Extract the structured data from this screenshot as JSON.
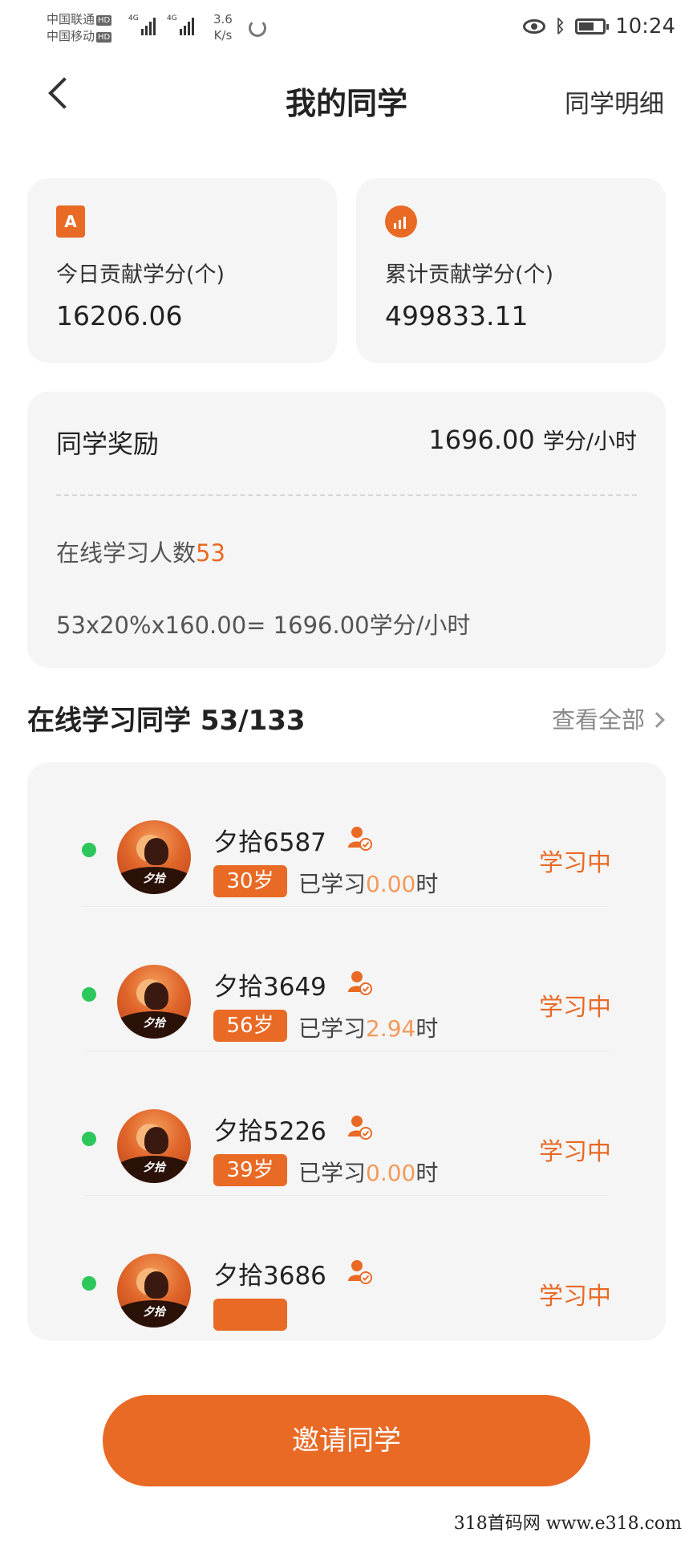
{
  "status_bar": {
    "carrier1": "中国联通",
    "carrier2": "中国移动",
    "hd": "HD",
    "net1": "4G",
    "net2": "4G",
    "speed_value": "3.6",
    "speed_unit": "K/s",
    "time": "10:24"
  },
  "nav": {
    "title": "我的同学",
    "detail_link": "同学明细"
  },
  "stats": {
    "today_label": "今日贡献学分(个)",
    "today_value": "16206.06",
    "total_label": "累计贡献学分(个)",
    "total_value": "499833.11"
  },
  "reward": {
    "title": "同学奖励",
    "rate_value": "1696.00",
    "rate_unit": "学分/小时",
    "online_label": "在线学习人数",
    "online_count": "53",
    "formula": "53x20%x160.00= 1696.00学分/小时"
  },
  "online_section": {
    "title": "在线学习同学 53/133",
    "view_all": "查看全部"
  },
  "classmates": [
    {
      "name": "夕拾6587",
      "age": "30岁",
      "studied_prefix": "已学习",
      "hours": "0.00",
      "hours_unit": "时",
      "state": "学习中",
      "avatar_text": "夕拾"
    },
    {
      "name": "夕拾3649",
      "age": "56岁",
      "studied_prefix": "已学习",
      "hours": "2.94",
      "hours_unit": "时",
      "state": "学习中",
      "avatar_text": "夕拾"
    },
    {
      "name": "夕拾5226",
      "age": "39岁",
      "studied_prefix": "已学习",
      "hours": "0.00",
      "hours_unit": "时",
      "state": "学习中",
      "avatar_text": "夕拾"
    },
    {
      "name": "夕拾3686",
      "age": "",
      "studied_prefix": "",
      "hours": "",
      "hours_unit": "",
      "state": "学习中",
      "avatar_text": "夕拾"
    }
  ],
  "invite_button": "邀请同学",
  "watermark": "318首码网   www.e318.com",
  "colors": {
    "accent": "#e86a25",
    "highlight": "#f29a5a",
    "online_dot": "#2cc75b",
    "card_bg": "#f5f5f5"
  }
}
